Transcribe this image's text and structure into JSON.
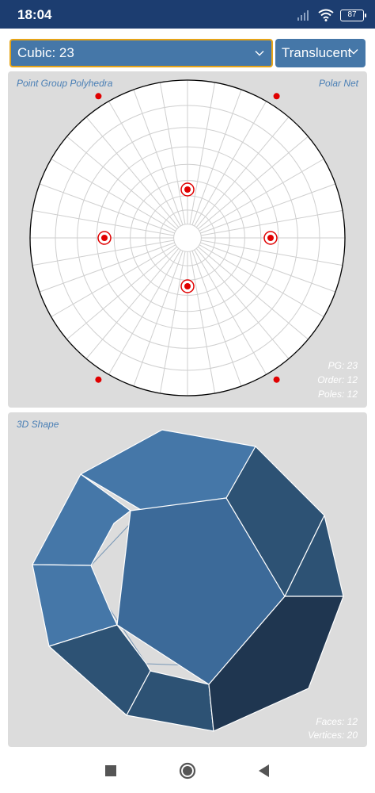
{
  "status_bar": {
    "time": "18:04",
    "battery": "87"
  },
  "selectors": {
    "point_group": "Cubic: 23",
    "render_style": "Translucent"
  },
  "net_panel": {
    "title": "Point Group Polyhedra",
    "net_type": "Polar Net",
    "pg": "PG: 23",
    "order": "Order: 12",
    "poles": "Poles: 12"
  },
  "shape_panel": {
    "title": "3D Shape",
    "faces": "Faces: 12",
    "vertices": "Vertices: 20",
    "colors": {
      "light": "#4577a8",
      "mid": "#2d5274",
      "dark": "#1f3650"
    }
  },
  "colors": {
    "statusbar": "#1c3d70",
    "accent": "#4577a8",
    "focus_border": "#e6a417",
    "pole": "#e00000",
    "panel_bg": "#dcdcdc"
  }
}
